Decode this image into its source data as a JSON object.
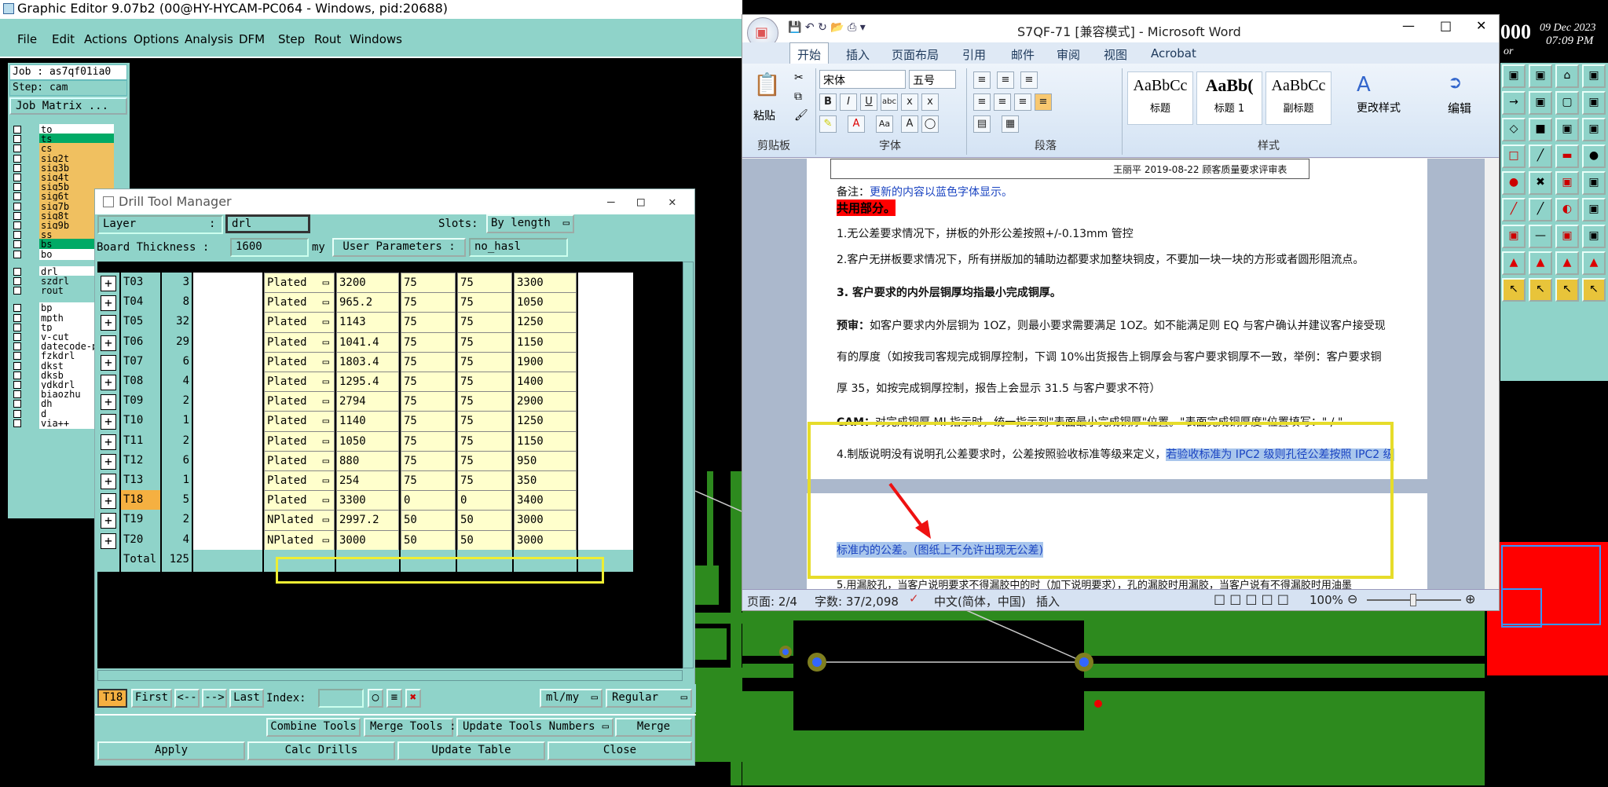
{
  "graphic_editor": {
    "title": "Graphic Editor 9.07b2 (00@HY-HYCAM-PC064 - Windows, pid:20688)",
    "menu": [
      "File",
      "Edit",
      "Actions",
      "Options",
      "Analysis",
      "DFM",
      "Step",
      "Rout",
      "Windows"
    ],
    "job_label": "Job : as7qf01ia0",
    "step_label": "Step: cam",
    "job_matrix_label": "Job Matrix ...",
    "layers": [
      {
        "name": "to",
        "color": "#ffffff"
      },
      {
        "name": "ts",
        "color": "#00aa66"
      },
      {
        "name": "cs",
        "color": "#f0c060"
      },
      {
        "name": "sig2t",
        "color": "#f0c060"
      },
      {
        "name": "sig3b",
        "color": "#f0c060"
      },
      {
        "name": "sig4t",
        "color": "#f0c060"
      },
      {
        "name": "sig5b",
        "color": "#f0c060"
      },
      {
        "name": "sig6t",
        "color": "#f0c060"
      },
      {
        "name": "sig7b",
        "color": "#f0c060"
      },
      {
        "name": "sig8t",
        "color": "#f0c060"
      },
      {
        "name": "sig9b",
        "color": "#f0c060"
      },
      {
        "name": "ss",
        "color": "#f0c060"
      },
      {
        "name": "bs",
        "color": "#00aa66"
      },
      {
        "name": "bo",
        "color": "#ffffff"
      }
    ],
    "drill_layers": [
      "drl",
      "szdrl",
      "rout"
    ],
    "other_layers": [
      "bp",
      "mpth",
      "tp",
      "v-cut",
      "datecode-p",
      "fzkdrl",
      "dkst",
      "dksb",
      "ydkdrl",
      "biaozhu",
      "dh",
      "d",
      "via++"
    ],
    "clock": {
      "time": "07:09 PM",
      "date": "09 Dec 2023",
      "year": "000",
      "sub": "or"
    }
  },
  "drill_tool_manager": {
    "title": "Drill Tool Manager",
    "layer_label": "Layer",
    "layer_sep": ":",
    "layer_value": "drl",
    "slots_label": "Slots:",
    "slots_value": "By length",
    "board_thickness_label": "Board Thickness :",
    "board_thickness_value": "1600",
    "board_thickness_unit": "my",
    "user_params_label": "User Parameters :",
    "user_params_value": "no_hasl",
    "rows": [
      {
        "tool": "T03",
        "count": "3",
        "type": "Plated",
        "size": "3200",
        "tp": "75",
        "tm": "75",
        "finish": "3300",
        "hl": false
      },
      {
        "tool": "T04",
        "count": "8",
        "type": "Plated",
        "size": "965.2",
        "tp": "75",
        "tm": "75",
        "finish": "1050",
        "hl": false
      },
      {
        "tool": "T05",
        "count": "32",
        "type": "Plated",
        "size": "1143",
        "tp": "75",
        "tm": "75",
        "finish": "1250",
        "hl": false
      },
      {
        "tool": "T06",
        "count": "29",
        "type": "Plated",
        "size": "1041.4",
        "tp": "75",
        "tm": "75",
        "finish": "1150",
        "hl": false
      },
      {
        "tool": "T07",
        "count": "6",
        "type": "Plated",
        "size": "1803.4",
        "tp": "75",
        "tm": "75",
        "finish": "1900",
        "hl": false
      },
      {
        "tool": "T08",
        "count": "4",
        "type": "Plated",
        "size": "1295.4",
        "tp": "75",
        "tm": "75",
        "finish": "1400",
        "hl": false
      },
      {
        "tool": "T09",
        "count": "2",
        "type": "Plated",
        "size": "2794",
        "tp": "75",
        "tm": "75",
        "finish": "2900",
        "hl": false
      },
      {
        "tool": "T10",
        "count": "1",
        "type": "Plated",
        "size": "1140",
        "tp": "75",
        "tm": "75",
        "finish": "1250",
        "hl": false
      },
      {
        "tool": "T11",
        "count": "2",
        "type": "Plated",
        "size": "1050",
        "tp": "75",
        "tm": "75",
        "finish": "1150",
        "hl": false
      },
      {
        "tool": "T12",
        "count": "6",
        "type": "Plated",
        "size": "880",
        "tp": "75",
        "tm": "75",
        "finish": "950",
        "hl": false
      },
      {
        "tool": "T13",
        "count": "1",
        "type": "Plated",
        "size": "254",
        "tp": "75",
        "tm": "75",
        "finish": "350",
        "hl": false
      },
      {
        "tool": "T18",
        "count": "5",
        "type": "Plated",
        "size": "3300",
        "tp": "0",
        "tm": "0",
        "finish": "3400",
        "hl": true
      },
      {
        "tool": "T19",
        "count": "2",
        "type": "NPlated",
        "size": "2997.2",
        "tp": "50",
        "tm": "50",
        "finish": "3000",
        "hl": false
      },
      {
        "tool": "T20",
        "count": "4",
        "type": "NPlated",
        "size": "3000",
        "tp": "50",
        "tm": "50",
        "finish": "3000",
        "hl": false
      }
    ],
    "total_label": "Total",
    "total_value": "125",
    "current_tool": "T18",
    "nav": {
      "first": "First",
      "prev": "<--",
      "next": "-->",
      "last": "Last",
      "index": "Index:"
    },
    "units_value": "ml/my",
    "mode_value": "Regular",
    "buttons": {
      "combine": "Combine Tools",
      "merge_tools": "Merge Tools :",
      "update_numbers": "Update Tools Numbers",
      "merge": "Merge",
      "apply": "Apply",
      "calc": "Calc Drills",
      "update_table": "Update Table",
      "close": "Close"
    }
  },
  "word": {
    "title": "S7QF-71 [兼容模式] - Microsoft Word",
    "tabs": [
      "开始",
      "插入",
      "页面布局",
      "引用",
      "邮件",
      "审阅",
      "视图",
      "Acrobat"
    ],
    "paste_label": "粘贴",
    "font_name": "宋体",
    "font_size": "五号",
    "styles": [
      {
        "preview": "AaBbCc",
        "name": "标题"
      },
      {
        "preview": "AaBb(",
        "name": "标题 1"
      },
      {
        "preview": "AaBbCc",
        "name": "副标题"
      }
    ],
    "change_styles": "更改样式",
    "edit_label": "编辑",
    "groups": {
      "clipboard": "剪贴板",
      "font": "字体",
      "paragraph": "段落",
      "styles": "样式"
    },
    "doc": {
      "signature": "王丽平 2019-08-22 顾客质量要求评审表",
      "note_prefix": "备注：",
      "note_body": "更新的内容以蓝色字体显示。",
      "common_heading": "共用部分。",
      "p1": "1.无公差要求情况下，拼板的外形公差按照+/-0.13mm 管控",
      "p2": "2.客户无拼板要求情况下，所有拼版加的辅助边都要求加整块铜皮，不要加一块一块的方形或者圆形阻流点。",
      "p3_num": "3.",
      "p3": "客户要求的内外层铜厚均指最小完成铜厚。",
      "p4_label": "预审：",
      "p4a": "如客户要求内外层铜为 1OZ，则最小要求需要满足 1OZ。如不能满足则 EQ 与客户确认并建议客户接受现",
      "p4b": "有的厚度（如按我司客规完成铜厚控制，下调 10%出货报告上铜厚会与客户要求铜厚不一致，举例：客户要求铜",
      "p4c": "厚 35，如按完成铜厚控制，报告上会显示 31.5 与客户要求不符）",
      "p5_label": "CAM：",
      "p5": "对完成铜厚 MI 指示时，统一指示到\"表面最小完成铜厚\"位置。\"表面完成铜厚度\"位置填写：\" / \"",
      "p6a": "4.制版说明没有说明孔公差要求时，公差按照验收标准等级来定义，",
      "p6b": "若验收标准为 IPC2 级则孔径公差按照 IPC2 级",
      "p6c": "标准内的公差。(图纸上不允许出现无公差)",
      "p7": "5.用漏胶孔，当客户说明要求不得漏胶中的时（加下说明要求），孔的漏胶时用漏胶，当客户说有不得漏胶时用油墨"
    },
    "status": {
      "page": "页面: 2/4",
      "words": "字数: 37/2,098",
      "lang": "中文(简体，中国)",
      "mode": "插入",
      "zoom": "100%"
    }
  }
}
